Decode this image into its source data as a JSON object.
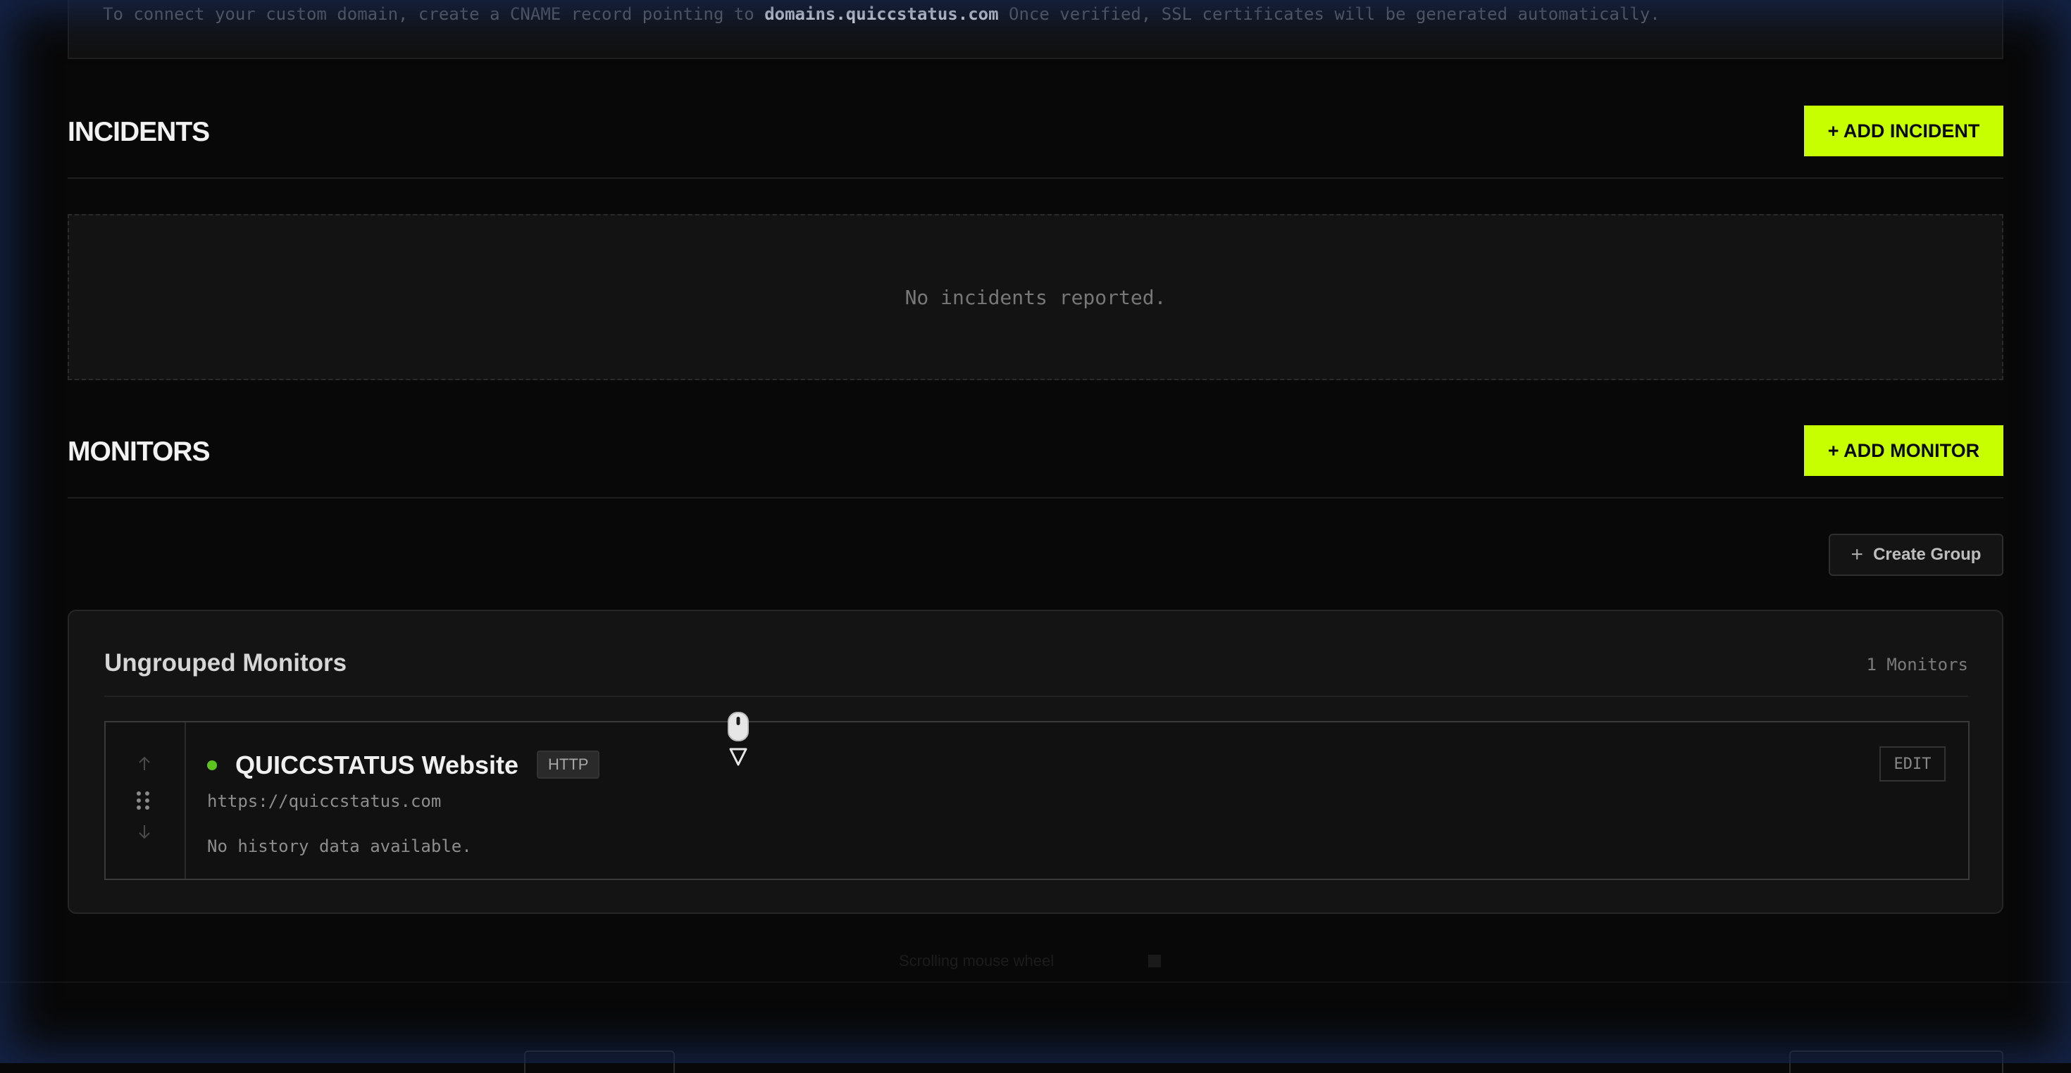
{
  "domain_notice": {
    "text_before": "To connect your custom domain, create a CNAME record pointing to",
    "domain": "domains.quiccstatus.com",
    "text_after": "Once verified, SSL certificates will be generated automatically."
  },
  "incidents": {
    "title": "INCIDENTS",
    "add_label": "+ ADD INCIDENT",
    "empty_text": "No incidents reported."
  },
  "monitors": {
    "title": "MONITORS",
    "add_label": "+ ADD MONITOR",
    "create_group_label": "Create Group",
    "group": {
      "title": "Ungrouped Monitors",
      "count_label": "1 Monitors",
      "items": [
        {
          "name": "QUICCSTATUS Website",
          "type": "HTTP",
          "url": "https://quiccstatus.com",
          "history": "No history data available.",
          "edit_label": "EDIT",
          "status_color": "#5cc31f"
        }
      ]
    }
  },
  "footer": {
    "hint": "Scrolling mouse wheel"
  },
  "colors": {
    "accent": "#c8ff00",
    "background": "#080808"
  }
}
